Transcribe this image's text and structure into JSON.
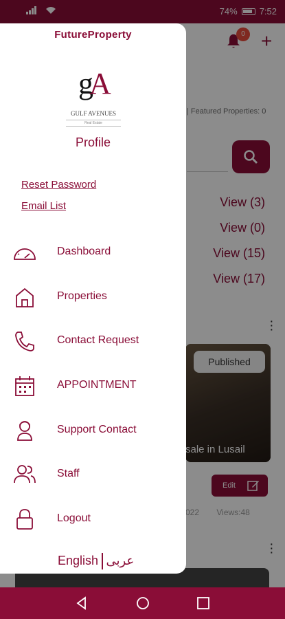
{
  "status_bar": {
    "battery": "74%",
    "time": "7:52"
  },
  "background": {
    "notification_count": "0",
    "featured_text": "| Featured Properties: 0",
    "views": [
      "View (3)",
      "View (0)",
      "View (15)",
      "View (17)"
    ],
    "published_label": "Published",
    "card_title": "sale in Lusail",
    "edit_label": "Edit",
    "stats_date": "022",
    "stats_views": "Views:48"
  },
  "drawer": {
    "app_title": "FutureProperty",
    "logo": {
      "mark_g": "g",
      "mark_a": "A",
      "name": "GULF AVENUES",
      "sub": "Real Estate"
    },
    "profile_label": "Profile",
    "links": {
      "reset_password": "Reset Password",
      "email_list": "Email List"
    },
    "menu": [
      {
        "label": "Dashboard",
        "icon": "dashboard-gauge-icon"
      },
      {
        "label": "Properties",
        "icon": "home-icon"
      },
      {
        "label": "Contact Request",
        "icon": "phone-icon"
      },
      {
        "label": "APPOINTMENT",
        "icon": "calendar-icon"
      },
      {
        "label": "Support Contact",
        "icon": "support-person-icon"
      },
      {
        "label": "Staff",
        "icon": "staff-users-icon"
      },
      {
        "label": "Logout",
        "icon": "lock-icon"
      }
    ],
    "language": {
      "english": "English",
      "arabic": "عربى"
    }
  },
  "colors": {
    "brand": "#8a0d37",
    "badge": "#e84b3c"
  }
}
